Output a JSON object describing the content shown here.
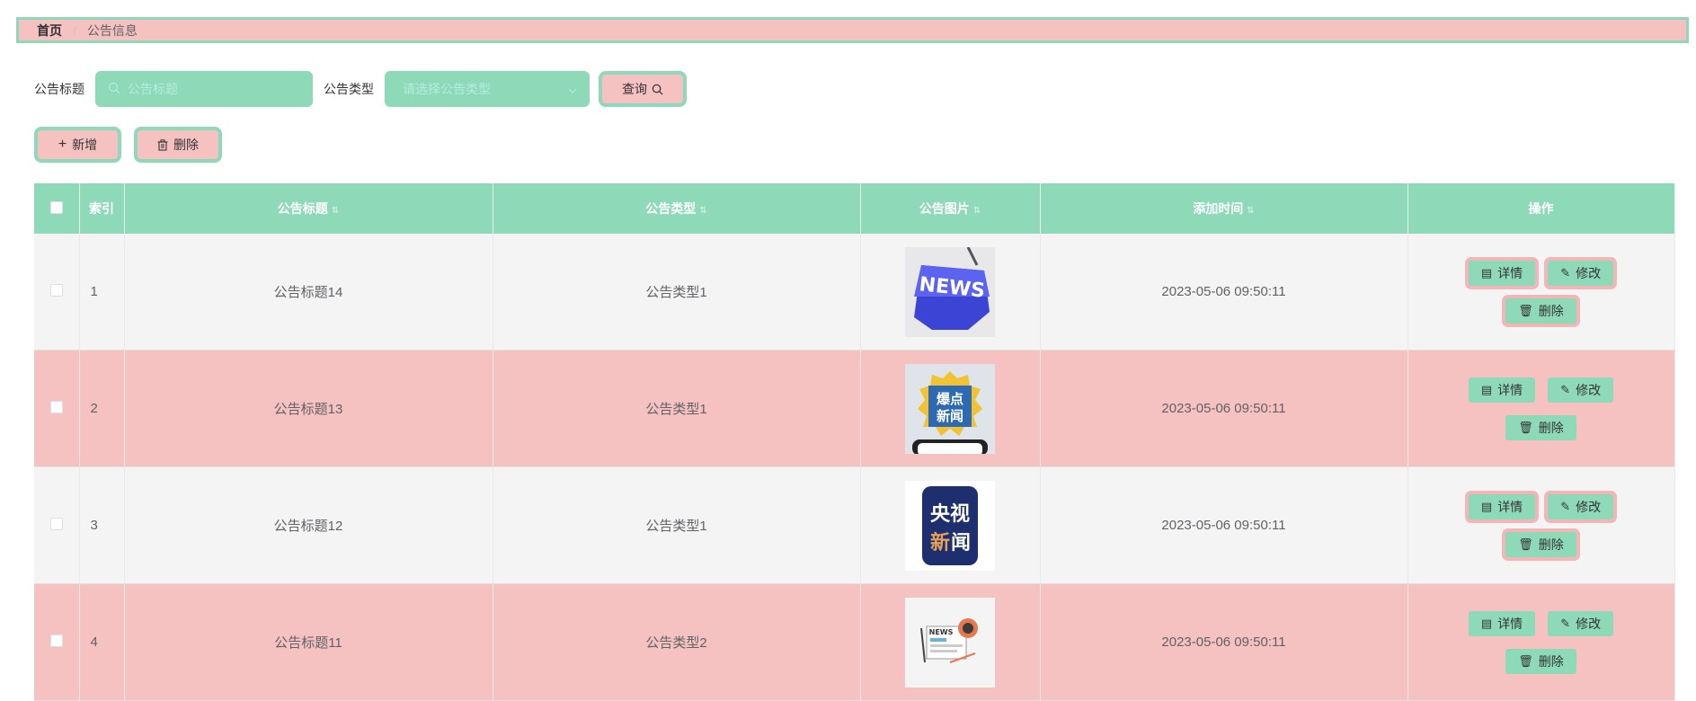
{
  "breadcrumb": {
    "home": "首页",
    "separator": "/",
    "current": "公告信息"
  },
  "search": {
    "title_label": "公告标题",
    "title_placeholder": "公告标题",
    "type_label": "公告类型",
    "type_placeholder": "请选择公告类型",
    "query_label": "查询"
  },
  "actions": {
    "add_label": "新增",
    "delete_label": "删除"
  },
  "table": {
    "headers": {
      "index": "索引",
      "title": "公告标题",
      "type": "公告类型",
      "image": "公告图片",
      "time": "添加时间",
      "ops": "操作"
    },
    "rows": [
      {
        "index": "1",
        "title": "公告标题14",
        "type": "公告类型1",
        "time": "2023-05-06 09:50:11",
        "image_text": "NEWS"
      },
      {
        "index": "2",
        "title": "公告标题13",
        "type": "公告类型1",
        "time": "2023-05-06 09:50:11",
        "image_text": "爆点新闻"
      },
      {
        "index": "3",
        "title": "公告标题12",
        "type": "公告类型1",
        "time": "2023-05-06 09:50:11",
        "image_text": "央视新闻"
      },
      {
        "index": "4",
        "title": "公告标题11",
        "type": "公告类型2",
        "time": "2023-05-06 09:50:11",
        "image_text": "NEWS"
      }
    ],
    "row_ops": {
      "detail": "详情",
      "edit": "修改",
      "delete": "删除"
    }
  },
  "colors": {
    "accent": "#8ed9b8",
    "pink": "#f6c1c1",
    "row_gray": "#f4f4f4"
  }
}
